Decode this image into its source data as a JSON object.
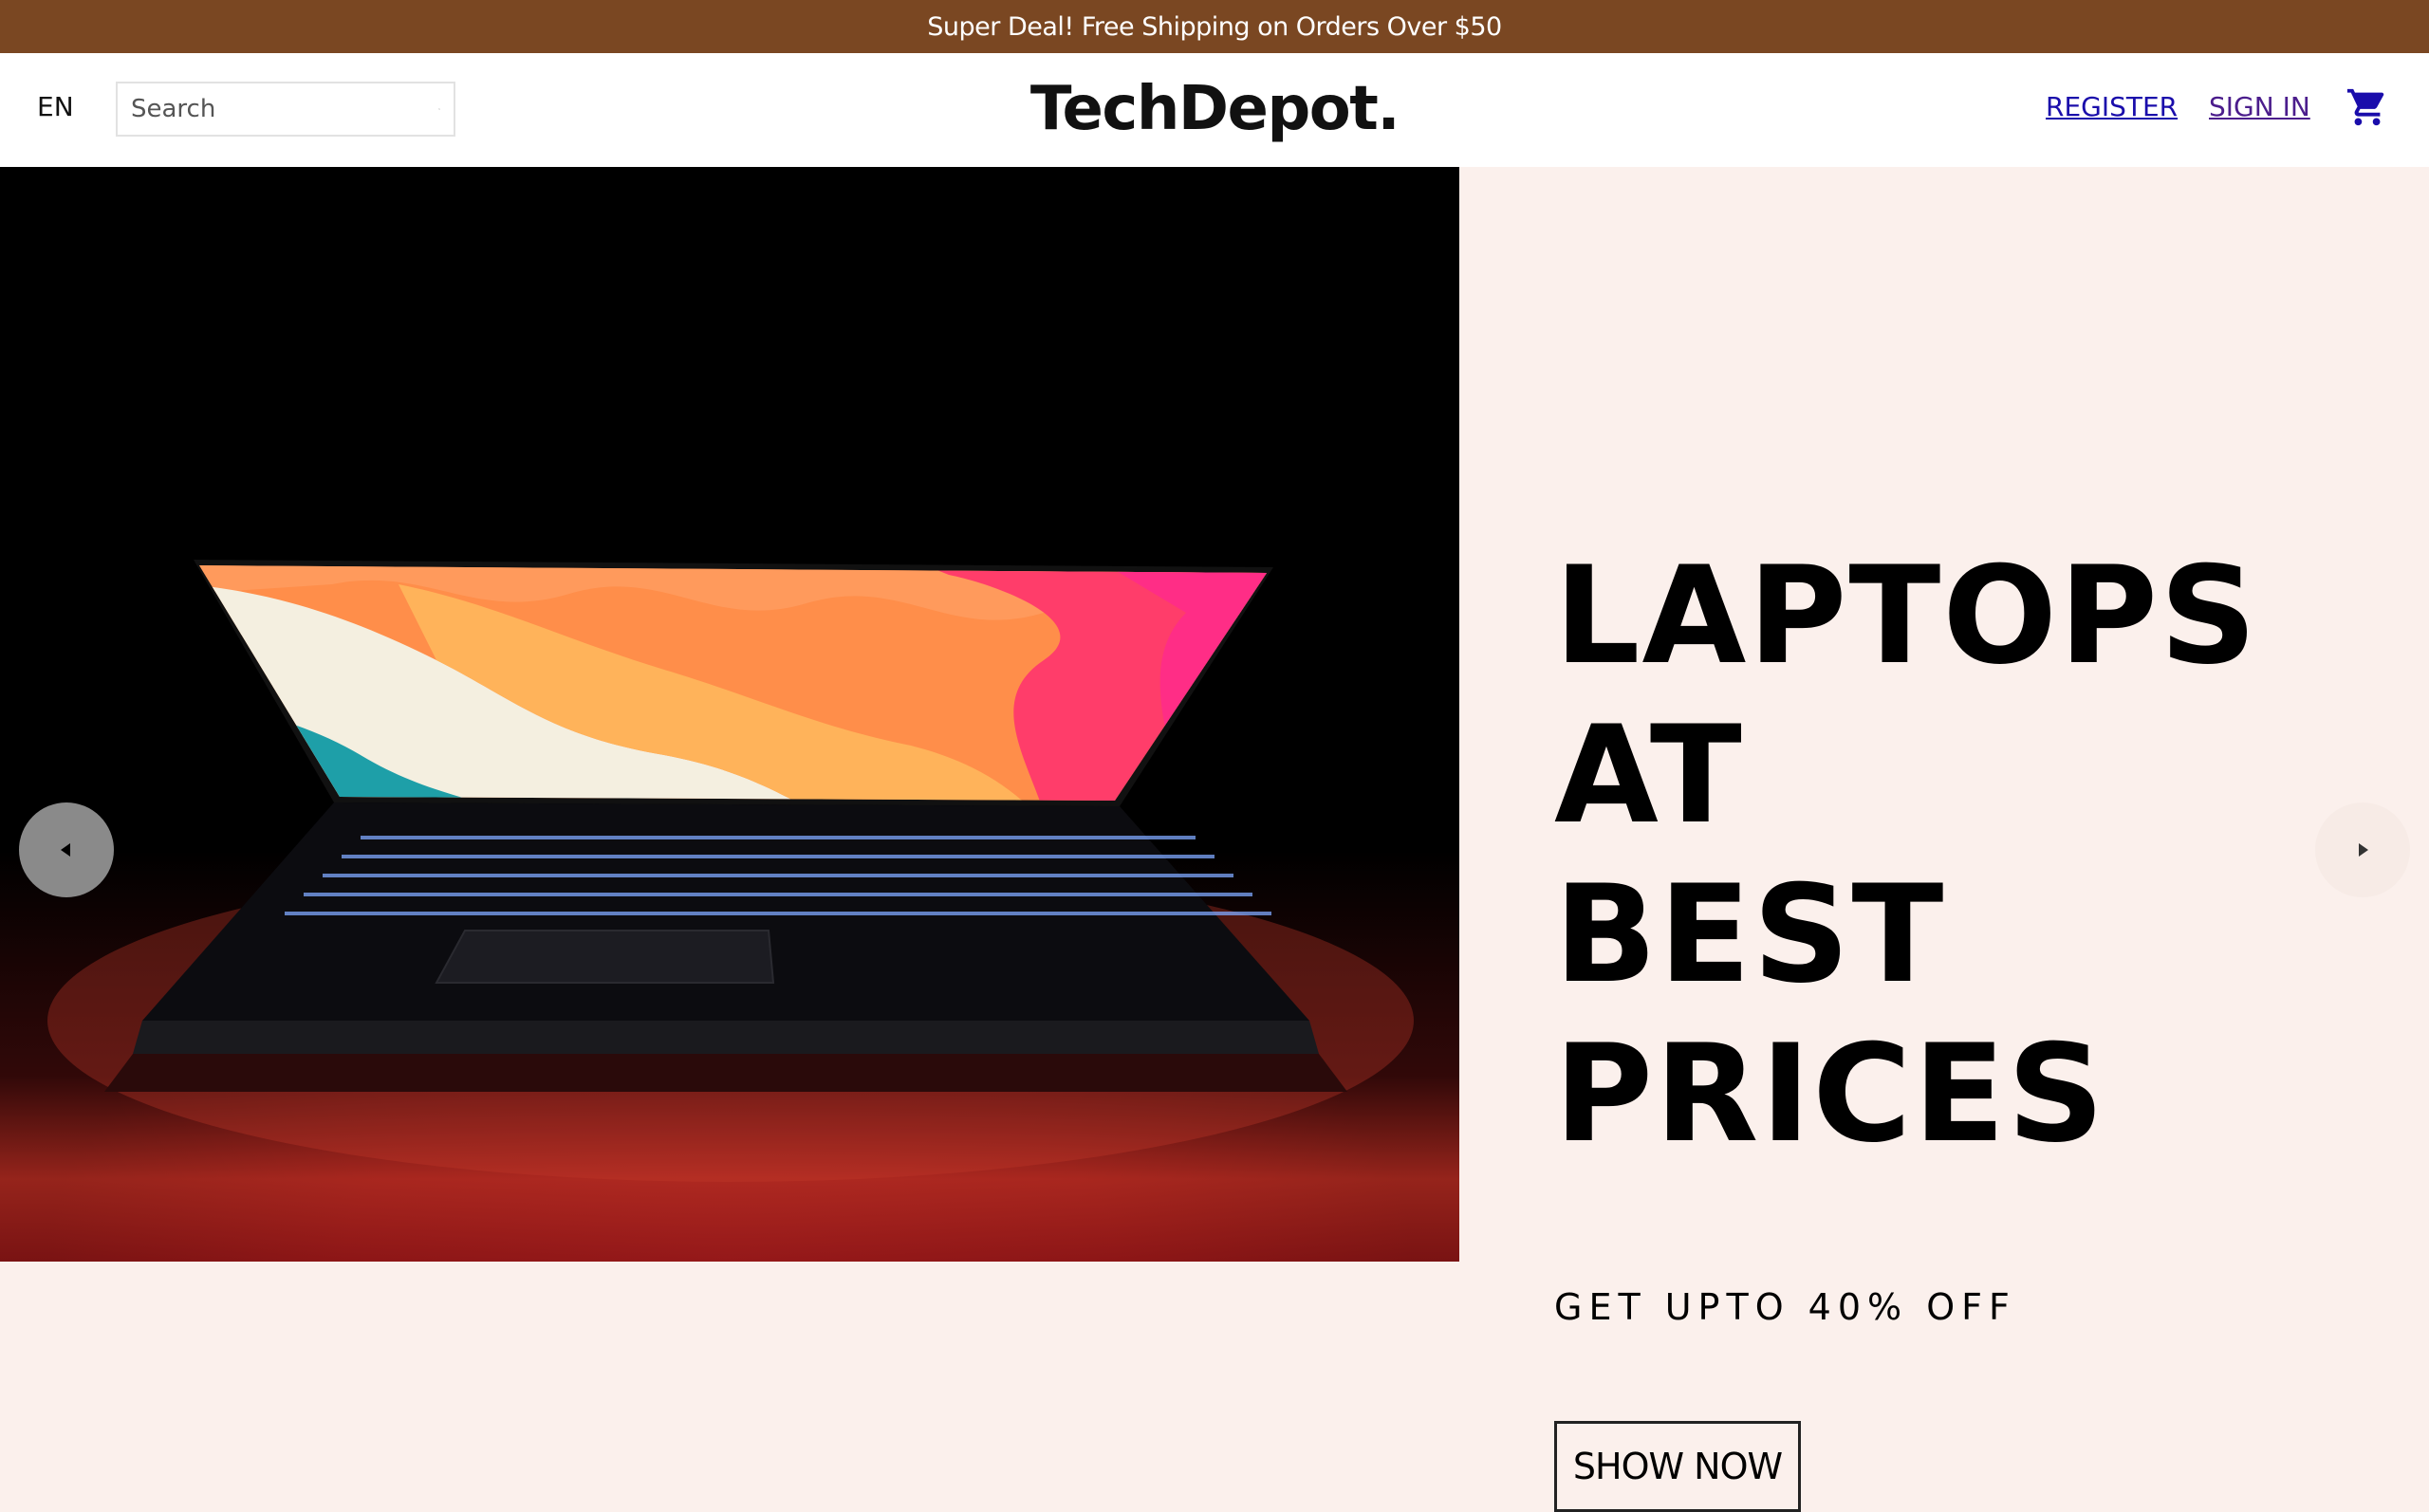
{
  "announcement": "Super Deal! Free Shipping on Orders Over $50",
  "navbar": {
    "language": "EN",
    "search_placeholder": "Search",
    "logo": "TechDepot.",
    "register": "REGISTER",
    "sign_in": "SIGN IN",
    "cart_icon": "shopping-cart-icon"
  },
  "hero": {
    "title_line1": "LAPTOPS AT",
    "title_line2": "BEST PRICES",
    "subtitle": "GET UPTO 40% OFF",
    "button": "SHOW NOW",
    "prev_icon": "arrow-left-icon",
    "next_icon": "arrow-right-icon"
  },
  "colors": {
    "announcement_bg": "#7a4722",
    "page_bg": "#fbf0ec",
    "register_link": "#1a0dab",
    "signin_link": "#4b1d8c",
    "cart_icon": "#1a0dab"
  }
}
